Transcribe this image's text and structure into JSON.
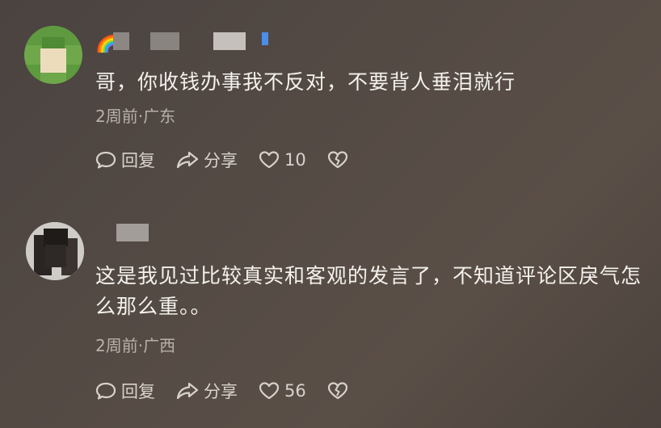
{
  "comments": [
    {
      "text": "哥，你收钱办事我不反对，不要背人垂泪就行",
      "time_location": "2周前·广东",
      "reply_label": "回复",
      "share_label": "分享",
      "like_count": "10",
      "badge_emoji": "🌈"
    },
    {
      "text": "这是我见过比较真实和客观的发言了，不知道评论区戾气怎\n么那么重。。",
      "time_location": "2周前·广西",
      "reply_label": "回复",
      "share_label": "分享",
      "like_count": "56"
    }
  ],
  "colors": {
    "background": "#4e4541",
    "text": "#f4f1ed",
    "meta": "#b8b0aa",
    "action": "#d8d2cd"
  },
  "icons": [
    "reply-icon",
    "share-icon",
    "like-icon",
    "dislike-icon",
    "rainbow-badge"
  ]
}
